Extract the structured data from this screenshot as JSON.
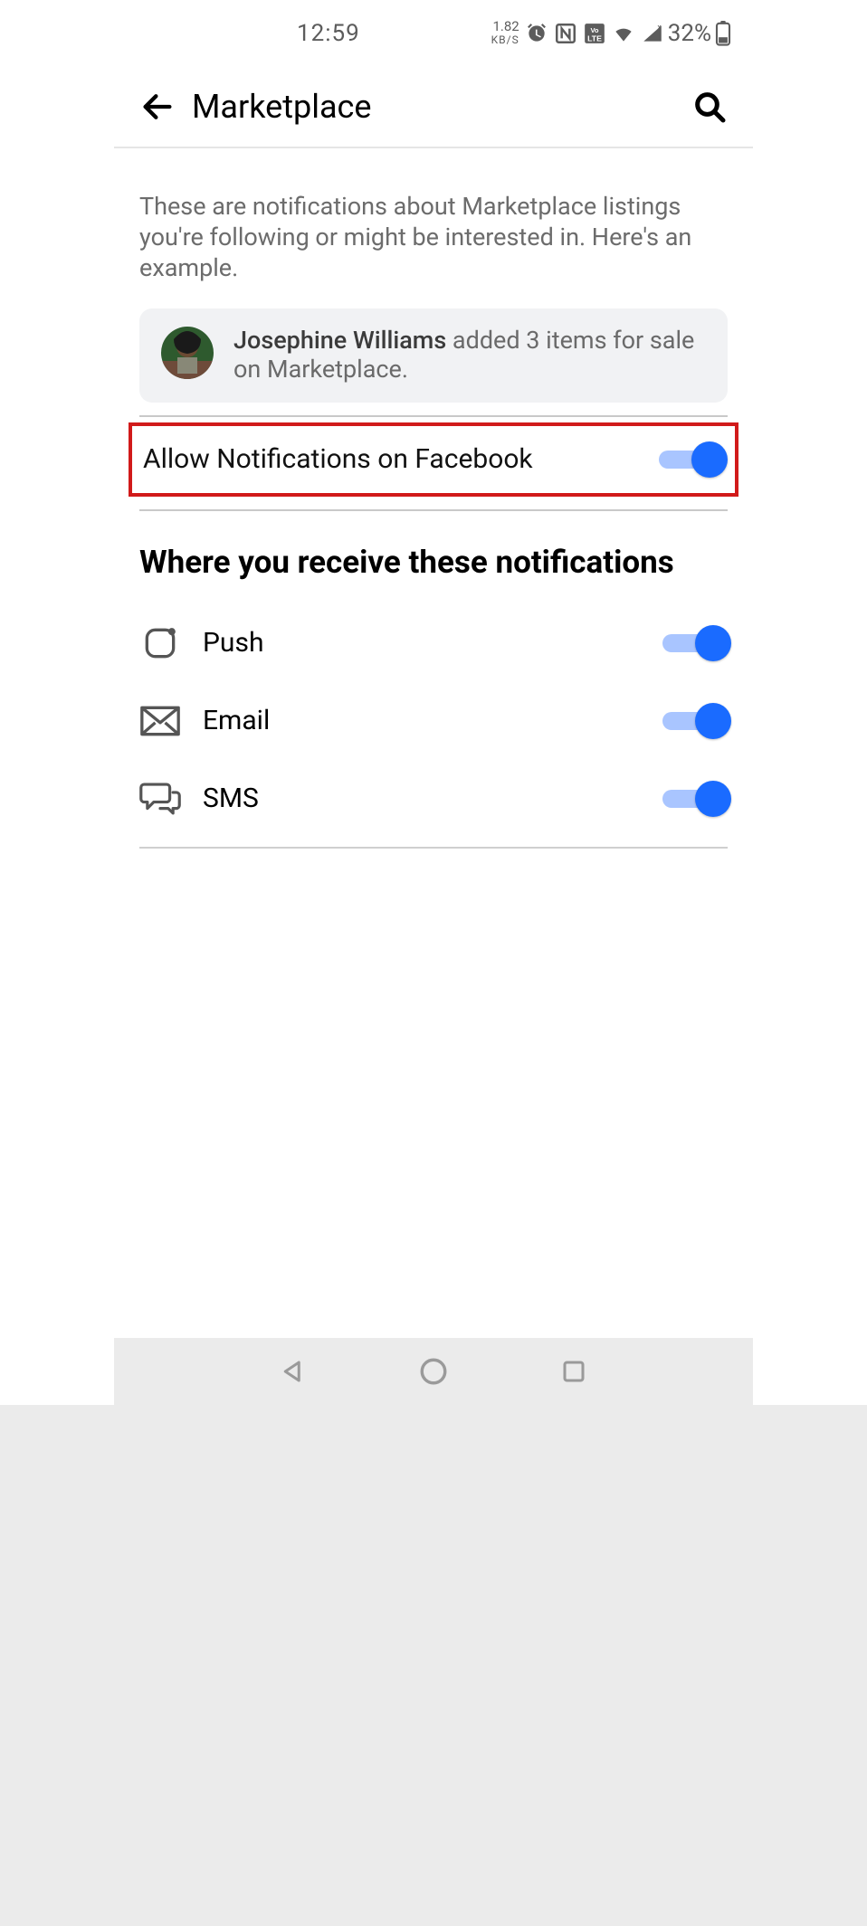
{
  "statusbar": {
    "time": "12:59",
    "net_speed_value": "1.82",
    "net_speed_unit": "KB/S",
    "battery_pct": "32%"
  },
  "header": {
    "title": "Marketplace"
  },
  "intro_text": "These are notifications about Marketplace listings you're following or might be interested in. Here's an example.",
  "example": {
    "name": "Josephine Williams",
    "action_text": " added 3 items for sale on Marketplace."
  },
  "allow": {
    "label": "Allow Notifications on Facebook",
    "enabled": true
  },
  "section_title": "Where you receive these notifications",
  "channels": {
    "push": {
      "label": "Push",
      "enabled": true
    },
    "email": {
      "label": "Email",
      "enabled": true
    },
    "sms": {
      "label": "SMS",
      "enabled": true
    }
  }
}
